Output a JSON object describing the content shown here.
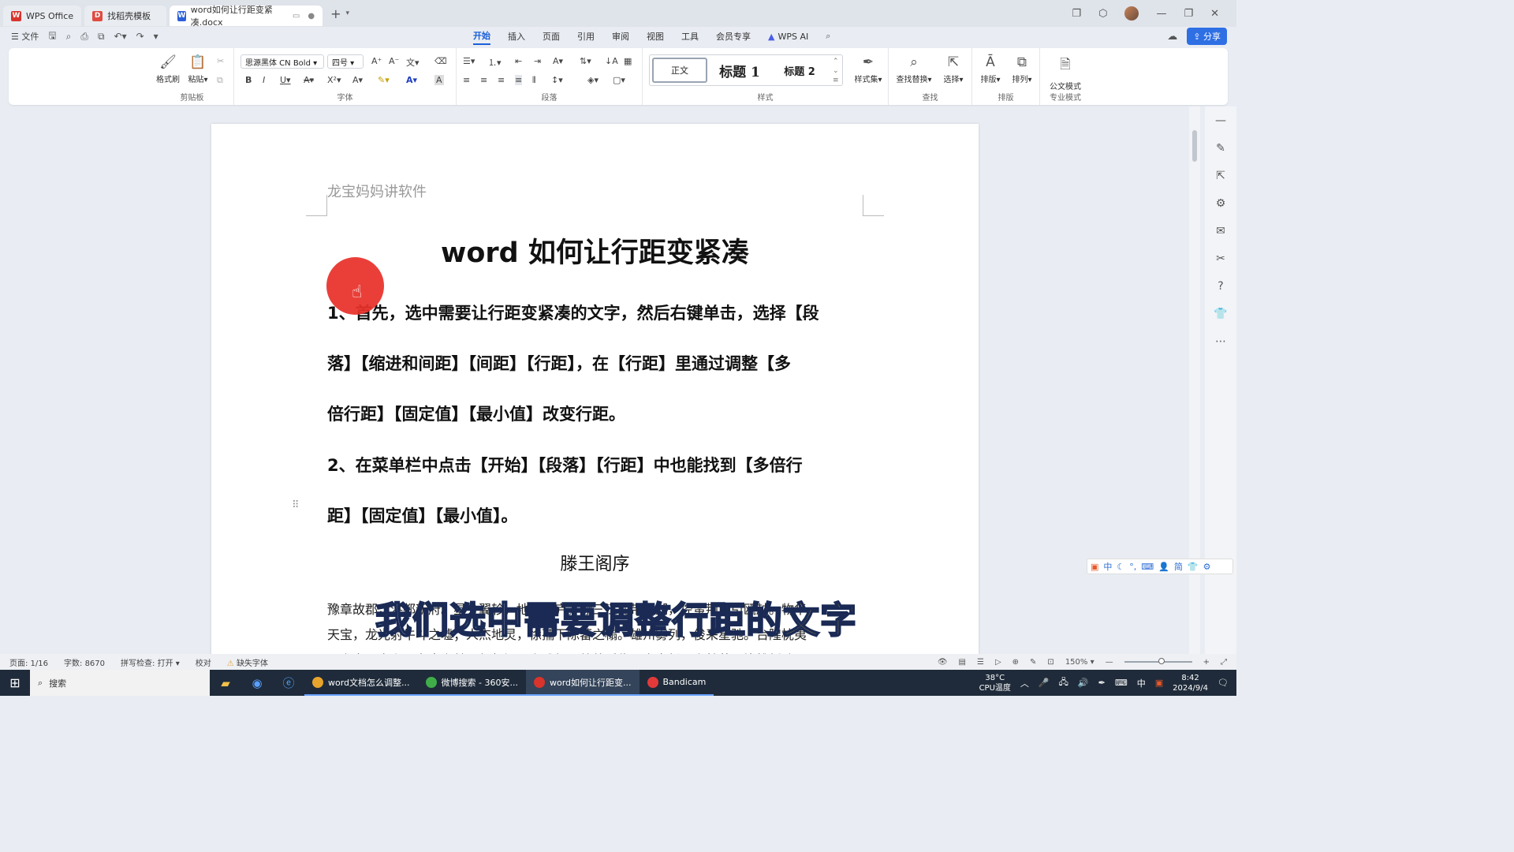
{
  "titlebar": {
    "tabs": [
      {
        "label": "WPS Office",
        "icon": "wps-logo-icon",
        "color": "#d9342b"
      },
      {
        "label": "找稻壳模板",
        "icon": "docer-icon",
        "color": "#e04b3f"
      },
      {
        "label": "word如何让行距变紧凑.docx",
        "icon": "word-doc-icon",
        "color": "#2b5fd9"
      }
    ],
    "new_tab": "+"
  },
  "menubar": {
    "file_label": "文件",
    "tabs": [
      "开始",
      "插入",
      "页面",
      "引用",
      "审阅",
      "视图",
      "工具",
      "会员专享"
    ],
    "active_tab": "开始",
    "wps_ai": "WPS AI",
    "share": "分享"
  },
  "ribbon": {
    "clipboard": {
      "label": "剪贴板",
      "format_painter": "格式刷",
      "paste": "粘贴"
    },
    "font": {
      "label": "字体",
      "font_name": "思源黑体 CN Bold",
      "font_size": "四号"
    },
    "paragraph": {
      "label": "段落"
    },
    "styles": {
      "label": "样式",
      "normal": "正文",
      "heading1": "标题 1",
      "heading2": "标题 2",
      "style_set": "样式集"
    },
    "find": {
      "label": "查找",
      "find_replace": "查找替换",
      "select": "选择"
    },
    "layout": {
      "label": "排版",
      "typeset": "排版",
      "arrange": "排列"
    },
    "pro": {
      "label": "专业模式",
      "official": "公文模式"
    }
  },
  "document": {
    "header": "龙宝妈妈讲软件",
    "title": "word 如何让行距变紧凑",
    "para1_lines": [
      "1、首先，选中需要让行距变紧凑的文字，然后右键单击，选择【段",
      "落】【缩进和间距】【间距】【行距】，在【行距】里通过调整【多",
      "倍行距】【固定值】【最小值】改变行距。"
    ],
    "para2_lines": [
      "2、在菜单栏中点击【开始】【段落】【行距】中也能找到【多倍行",
      "距】【固定值】【最小值】。"
    ],
    "subtitle": "滕王阁序",
    "body_lines": [
      "豫章故郡，洪都新府。星分翼轸，地接衡庐。襟三江而带五湖，控蛮荆而引瓯越。物华",
      "天宝，龙光射牛斗之墟；人杰地灵，徐孺下陈蕃之榻。雄州雾列，俊采星驰。台隍枕夷",
      "夏之交，宾主尽东南之美。都督阎公之雅望，棨戟遥临；宇文新州之懿范，襜帷暂驻。"
    ]
  },
  "caption": {
    "part_a": "我们选中需要",
    "part_b": "调整行距",
    "part_c": "的",
    "part_d": "文字"
  },
  "ime": {
    "mode": "中",
    "simplified": "简"
  },
  "statusbar": {
    "page": "页面: 1/16",
    "words": "字数: 8670",
    "spell": "拼写检查: 打开",
    "proof": "校对",
    "missing_font": "缺失字体",
    "zoom": "150%",
    "zoom_fraction": 0.55
  },
  "taskbar": {
    "search": "搜索",
    "apps": [
      {
        "label": "word文档怎么调整...",
        "color": "#e8a42c"
      },
      {
        "label": "微博搜索 - 360安...",
        "color": "#3fae49"
      },
      {
        "label": "word如何让行距变...",
        "color": "#d9342b"
      },
      {
        "label": "Bandicam",
        "color": "#e23a3a"
      }
    ],
    "temp": "38°C",
    "temp_label": "CPU温度",
    "ime": "中",
    "time": "8:42",
    "date": "2024/9/4"
  }
}
